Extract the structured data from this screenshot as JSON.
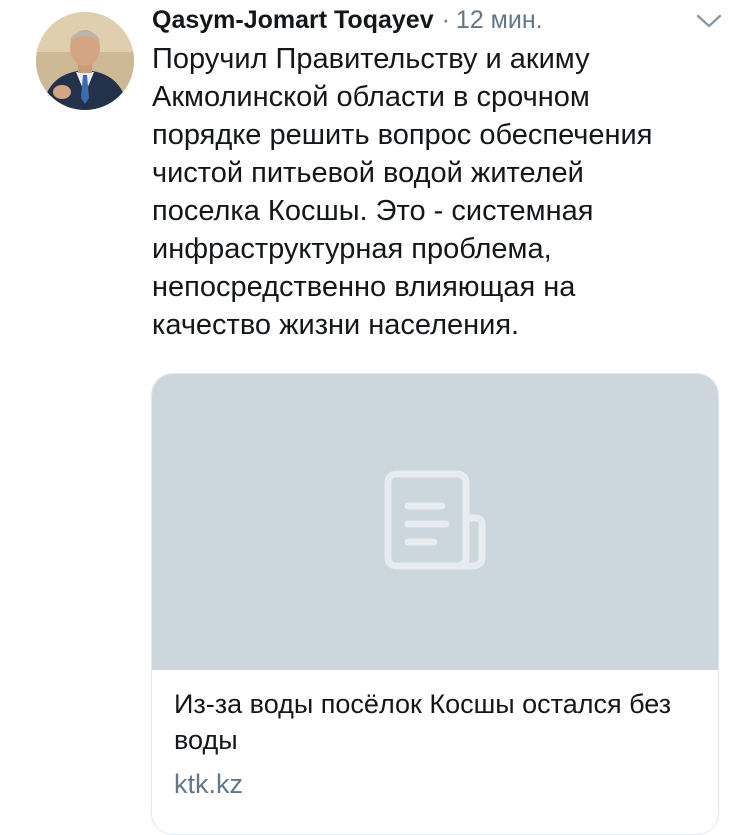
{
  "tweet": {
    "author_name": "Qasym-Jomart Toqayev",
    "separator": "·",
    "timestamp": "12 мин.",
    "text": "Поручил Правительству и акиму\nАкмолинской области в срочном\nпорядке решить вопрос обеспечения\nчистой питьевой водой жителей\nпоселка Косшы. Это - системная\nинфраструктурная проблема,\nнепосредственно влияющая на\nкачество жизни населения."
  },
  "card": {
    "title": "Из-за воды посёлок Косшы остался без воды",
    "domain": "ktk.kz",
    "placeholder_icon": "document-icon"
  },
  "icons": {
    "menu": "chevron-down-icon",
    "avatar": "avatar"
  },
  "colors": {
    "text_primary": "#14171a",
    "text_secondary": "#657786",
    "card_media_bg": "#ccd6dd",
    "card_border": "#e1e8ed",
    "icon_placeholder": "#e6ecf0"
  }
}
